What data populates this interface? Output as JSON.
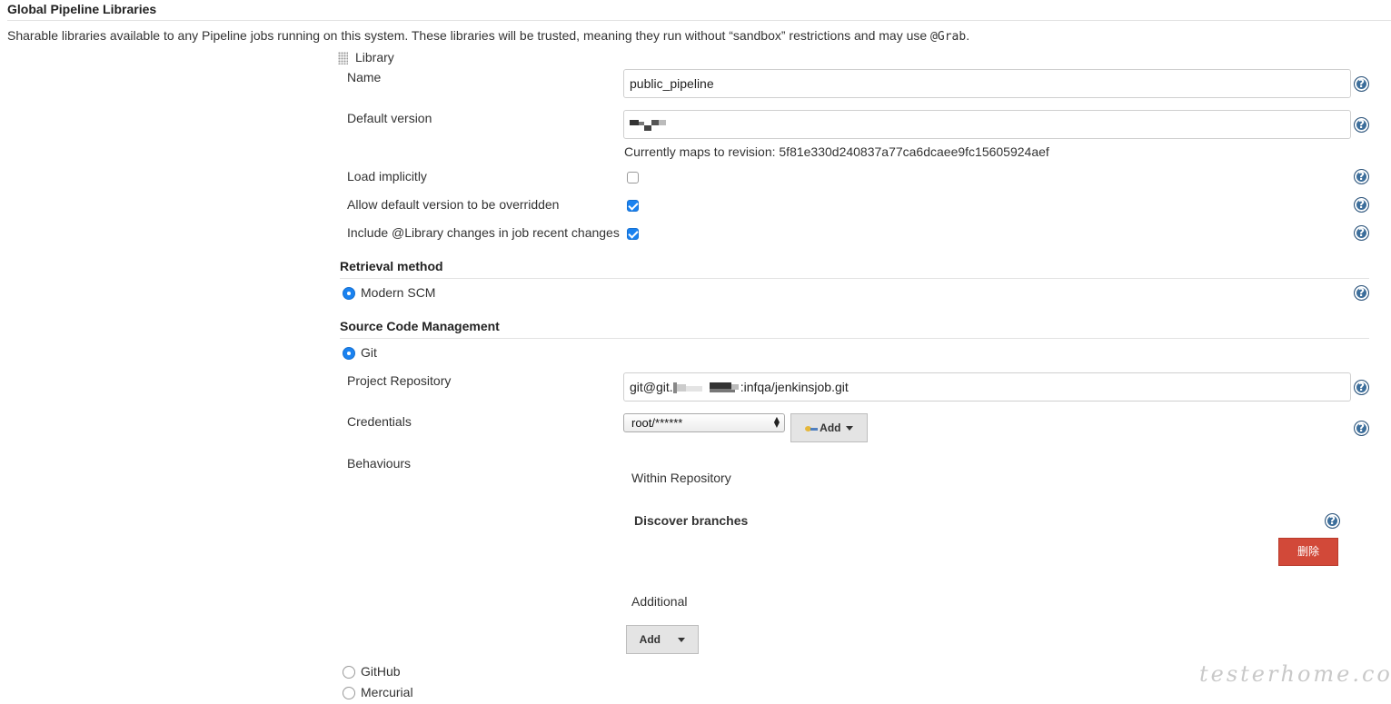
{
  "header": {
    "title": "Global Pipeline Libraries",
    "description_prefix": "Sharable libraries available to any Pipeline jobs running on this system. These libraries will be trusted, meaning they run without “sandbox” restrictions and may use ",
    "description_code": "@Grab",
    "description_suffix": "."
  },
  "library": {
    "heading": "Library",
    "name_label": "Name",
    "name_value": "public_pipeline",
    "default_version_label": "Default version",
    "default_version_value": "",
    "revision_text": "Currently maps to revision: 5f81e330d240837a77ca6dcaee9fc15605924aef",
    "load_implicitly_label": "Load implicitly",
    "load_implicitly_checked": false,
    "allow_override_label": "Allow default version to be overridden",
    "allow_override_checked": true,
    "include_changes_label": "Include @Library changes in job recent changes",
    "include_changes_checked": true
  },
  "retrieval": {
    "heading": "Retrieval method",
    "option_modern_scm": "Modern SCM"
  },
  "scm": {
    "heading": "Source Code Management",
    "option_git": "Git",
    "project_repository_label": "Project Repository",
    "project_repository_prefix": "git@git.",
    "project_repository_suffix": ":infqa/jenkinsjob.git",
    "credentials_label": "Credentials",
    "credentials_selected": "root/******",
    "credentials_add_label": "Add",
    "behaviours_label": "Behaviours",
    "within_repository_label": "Within Repository",
    "discover_branches_label": "Discover branches",
    "delete_button_label": "删除",
    "additional_label": "Additional",
    "additional_add_label": "Add",
    "option_github": "GitHub",
    "option_mercurial": "Mercurial"
  },
  "icons": {
    "help": "help-icon",
    "drag": "drag-handle-icon",
    "key": "key-icon"
  },
  "colors": {
    "accent": "#1a82f0",
    "help_icon": "#3c6e9b",
    "delete_button": "#d24939"
  },
  "watermark": "testerhome.com"
}
